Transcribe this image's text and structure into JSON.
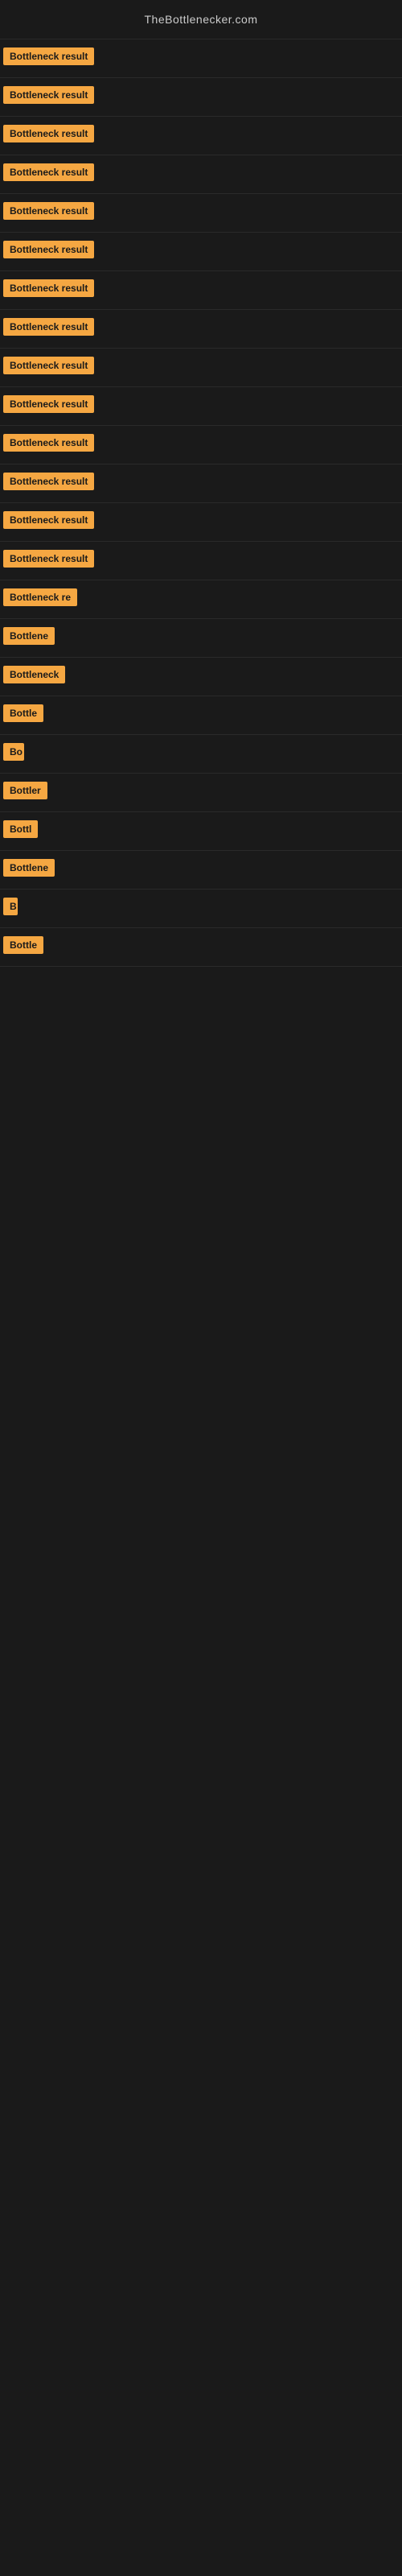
{
  "site": {
    "title": "TheBottlenecker.com"
  },
  "badges": [
    {
      "id": 1,
      "label": "Bottleneck result",
      "width": 120
    },
    {
      "id": 2,
      "label": "Bottleneck result",
      "width": 120
    },
    {
      "id": 3,
      "label": "Bottleneck result",
      "width": 120
    },
    {
      "id": 4,
      "label": "Bottleneck result",
      "width": 120
    },
    {
      "id": 5,
      "label": "Bottleneck result",
      "width": 120
    },
    {
      "id": 6,
      "label": "Bottleneck result",
      "width": 120
    },
    {
      "id": 7,
      "label": "Bottleneck result",
      "width": 120
    },
    {
      "id": 8,
      "label": "Bottleneck result",
      "width": 120
    },
    {
      "id": 9,
      "label": "Bottleneck result",
      "width": 120
    },
    {
      "id": 10,
      "label": "Bottleneck result",
      "width": 120
    },
    {
      "id": 11,
      "label": "Bottleneck result",
      "width": 120
    },
    {
      "id": 12,
      "label": "Bottleneck result",
      "width": 115
    },
    {
      "id": 13,
      "label": "Bottleneck result",
      "width": 120
    },
    {
      "id": 14,
      "label": "Bottleneck result",
      "width": 115
    },
    {
      "id": 15,
      "label": "Bottleneck re",
      "width": 95
    },
    {
      "id": 16,
      "label": "Bottlene",
      "width": 72
    },
    {
      "id": 17,
      "label": "Bottleneck",
      "width": 80
    },
    {
      "id": 18,
      "label": "Bottle",
      "width": 58
    },
    {
      "id": 19,
      "label": "Bo",
      "width": 26
    },
    {
      "id": 20,
      "label": "Bottler",
      "width": 60
    },
    {
      "id": 21,
      "label": "Bottl",
      "width": 50
    },
    {
      "id": 22,
      "label": "Bottlene",
      "width": 72
    },
    {
      "id": 23,
      "label": "B",
      "width": 18
    },
    {
      "id": 24,
      "label": "Bottle",
      "width": 58
    }
  ]
}
